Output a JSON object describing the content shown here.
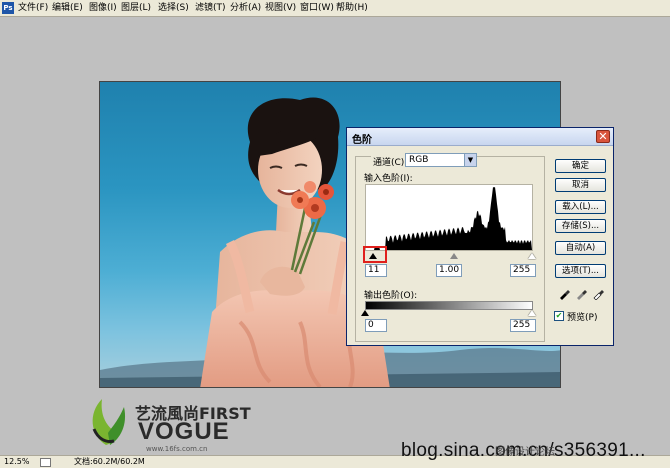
{
  "menubar": {
    "logo": "Ps",
    "items": [
      "文件(F)",
      "编辑(E)",
      "图像(I)",
      "图层(L)",
      "选择(S)",
      "滤镜(T)",
      "分析(A)",
      "视图(V)",
      "窗口(W)",
      "帮助(H)"
    ]
  },
  "status": {
    "zoom": "12.5%",
    "doc": "文档:60.2M/60.2M"
  },
  "watermarks": {
    "blog": "blog.sina.com.cn/s356391...",
    "blog_cn": "图像设计论坛",
    "brand_cn": "艺流風尚FIRST",
    "brand_en": "VOGUE",
    "url": "www.16fs.com.cn"
  },
  "levels_dialog": {
    "title": "色阶",
    "channel_label": "通道(C):",
    "channel_value": "RGB",
    "input_levels_label": "输入色阶(I):",
    "input_black": "11",
    "input_gamma": "1.00",
    "input_white": "255",
    "output_levels_label": "输出色阶(O):",
    "output_black": "0",
    "output_white": "255",
    "buttons": {
      "ok": "确定",
      "cancel": "取消",
      "load": "载入(L)...",
      "save": "存储(S)...",
      "auto": "自动(A)",
      "options": "选项(T)..."
    },
    "preview_label": "预览(P)",
    "preview_checked": true
  },
  "colors": {
    "sky": "#2b95c1",
    "dialog_bg": "#ece9d8",
    "highlight_box": "#e0201c",
    "close_button": "#d9543b"
  }
}
